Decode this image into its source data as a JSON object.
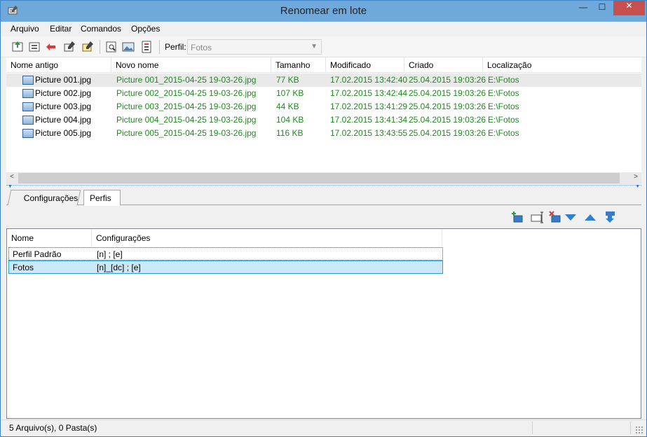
{
  "window": {
    "title": "Renomear em lote",
    "app_icon": "renamer-app-icon",
    "controls": {
      "minimize": "—",
      "maximize": "☐",
      "close": "✕"
    }
  },
  "menu": [
    "Arquivo",
    "Editar",
    "Comandos",
    "Opções"
  ],
  "toolbar": {
    "icons": [
      "add-files-icon",
      "add-folder-icon",
      "remove-icon",
      "rename-icon",
      "undo-rename-icon",
      "preview-icon",
      "image-info-icon",
      "properties-icon"
    ],
    "perfil_label": "Perfil:",
    "perfil_value": "Fotos"
  },
  "file_list": {
    "columns": [
      "Nome antigo",
      "Novo nome",
      "Tamanho",
      "Modificado",
      "Criado",
      "Localização"
    ],
    "rows": [
      {
        "old": "Picture 001.jpg",
        "new": "Picture 001_2015-04-25 19-03-26.jpg",
        "size": "77 KB",
        "modified": "17.02.2015 13:42:40",
        "created": "25.04.2015 19:03:26",
        "location": "E:\\Fotos"
      },
      {
        "old": "Picture 002.jpg",
        "new": "Picture 002_2015-04-25 19-03-26.jpg",
        "size": "107 KB",
        "modified": "17.02.2015 13:42:44",
        "created": "25.04.2015 19:03:26",
        "location": "E:\\Fotos"
      },
      {
        "old": "Picture 003.jpg",
        "new": "Picture 003_2015-04-25 19-03-26.jpg",
        "size": "44 KB",
        "modified": "17.02.2015 13:41:29",
        "created": "25.04.2015 19:03:26",
        "location": "E:\\Fotos"
      },
      {
        "old": "Picture 004.jpg",
        "new": "Picture 004_2015-04-25 19-03-26.jpg",
        "size": "104 KB",
        "modified": "17.02.2015 13:41:34",
        "created": "25.04.2015 19:03:26",
        "location": "E:\\Fotos"
      },
      {
        "old": "Picture 005.jpg",
        "new": "Picture 005_2015-04-25 19-03-26.jpg",
        "size": "116 KB",
        "modified": "17.02.2015 13:43:55",
        "created": "25.04.2015 19:03:26",
        "location": "E:\\Fotos"
      }
    ]
  },
  "tabs": [
    "Configurações",
    "Perfis"
  ],
  "active_tab": "Perfis",
  "profile_toolbar": [
    "add-profile-icon",
    "rename-profile-icon",
    "delete-profile-icon",
    "move-down-icon",
    "move-up-icon",
    "import-icon"
  ],
  "profiles": {
    "columns": [
      "Nome",
      "Configurações"
    ],
    "rows": [
      {
        "name": "Perfil Padrão",
        "config": "[n] ; [e]"
      },
      {
        "name": "Fotos",
        "config": "[n]_[dc] ; [e]"
      }
    ]
  },
  "status": {
    "text": "5 Arquivo(s), 0 Pasta(s)"
  },
  "colors": {
    "titlebar": "#6fa9dc",
    "close": "#c7504c",
    "green_text": "#1f8a1f",
    "selection": "#cce8f7"
  }
}
